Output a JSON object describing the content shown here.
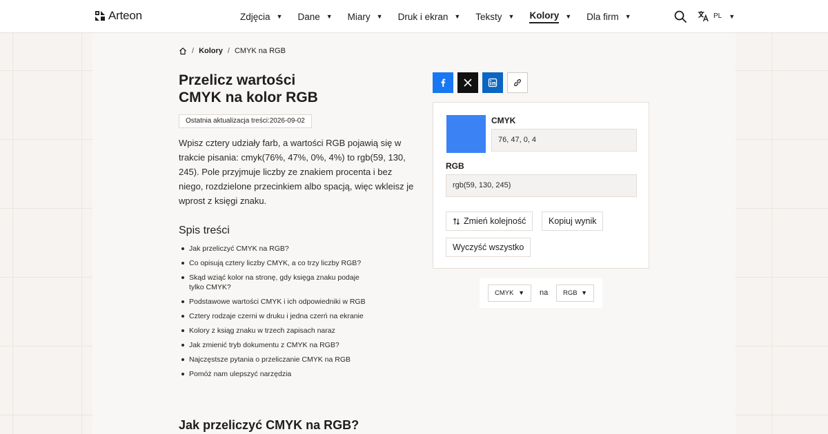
{
  "header": {
    "brand": "Arteon",
    "nav": [
      {
        "label": "Zdjęcia"
      },
      {
        "label": "Dane"
      },
      {
        "label": "Miary"
      },
      {
        "label": "Druk i ekran"
      },
      {
        "label": "Teksty"
      },
      {
        "label": "Kolory",
        "active": true
      },
      {
        "label": "Dla firm"
      }
    ],
    "search_icon": "search-icon",
    "language": "PL",
    "language_icon": "translate-icon"
  },
  "breadcrumb": {
    "items": [
      "Kolory",
      "CMYK na RGB"
    ],
    "home_icon": "home-icon"
  },
  "page": {
    "title_line1": "Przelicz wartości",
    "title_line2": "CMYK na kolor RGB",
    "updated": "Ostatnia aktualizacja treści:2026-09-02",
    "intro": "Wpisz cztery udziały farb, a wartości RGB pojawią się w trakcie pisania: cmyk(76%, 47%, 0%, 4%) to rgb(59, 130, 245). Pole przyjmuje liczby ze znakiem procenta i bez niego, rozdzielone przecinkiem albo spacją, więc wkleisz je wprost z księgi znaku."
  },
  "toc": {
    "heading": "Spis treści",
    "items": [
      "Jak przeliczyć CMYK na RGB?",
      "Co opisują cztery liczby CMYK, a co trzy liczby RGB?",
      "Skąd wziąć kolor na stronę, gdy księga znaku podaje tylko CMYK?",
      "Podstawowe wartości CMYK i ich odpowiedniki w RGB",
      "Cztery rodzaje czerni w druku i jedna czerń na ekranie",
      "Kolory z ksiąg znaku w trzech zapisach naraz",
      "Jak zmienić tryb dokumentu z CMYK na RGB?",
      "Najczęstsze pytania o przeliczanie CMYK na RGB",
      "Pomóż nam ulepszyć narzędzia"
    ]
  },
  "section_heading": "Jak przeliczyć CMYK na RGB?",
  "share": {
    "icons": [
      "facebook-icon",
      "x-icon",
      "linkedin-icon",
      "link-icon"
    ],
    "colors": {
      "facebook": "#1877f2",
      "x": "#111111",
      "linkedin": "#0a66c2"
    }
  },
  "converter": {
    "swatch_color": "#3b82f5",
    "cmyk_label": "CMYK",
    "cmyk_value": "76, 47, 0, 4",
    "rgb_label": "RGB",
    "rgb_value": "rgb(59, 130, 245)",
    "swap_label": "Zmień kolejność",
    "copy_label": "Kopiuj wynik",
    "clear_label": "Wyczyść wszystko"
  },
  "units": {
    "from": "CMYK",
    "connector": "na",
    "to": "RGB"
  }
}
